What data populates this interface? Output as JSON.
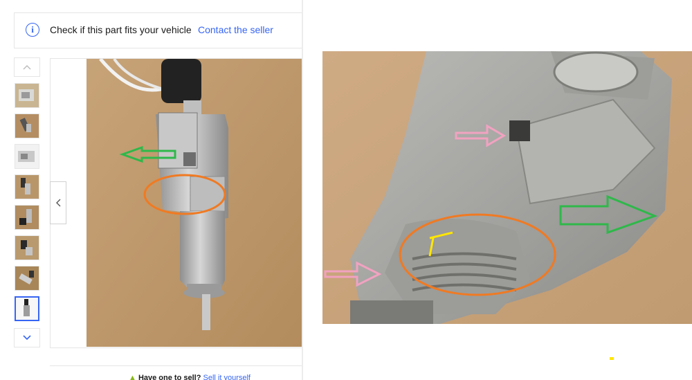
{
  "fit_bar": {
    "info_icon": "info-icon",
    "text": "Check if this part fits your vehicle",
    "contact_link": "Contact the seller"
  },
  "gallery": {
    "thumbnail_count": 8,
    "selected_index": 7,
    "up_icon": "chevron-up-icon",
    "down_icon": "chevron-down-icon",
    "prev_icon": "chevron-left-icon"
  },
  "sell": {
    "prompt": "Have one to sell?",
    "link": "Sell it yourself"
  },
  "colors": {
    "link": "#3665f3",
    "border": "#e5e5e5",
    "annotation_green": "#2fb84a",
    "annotation_orange": "#f07a22",
    "annotation_pink": "#f2a2c0",
    "annotation_yellow": "#ffe600"
  }
}
